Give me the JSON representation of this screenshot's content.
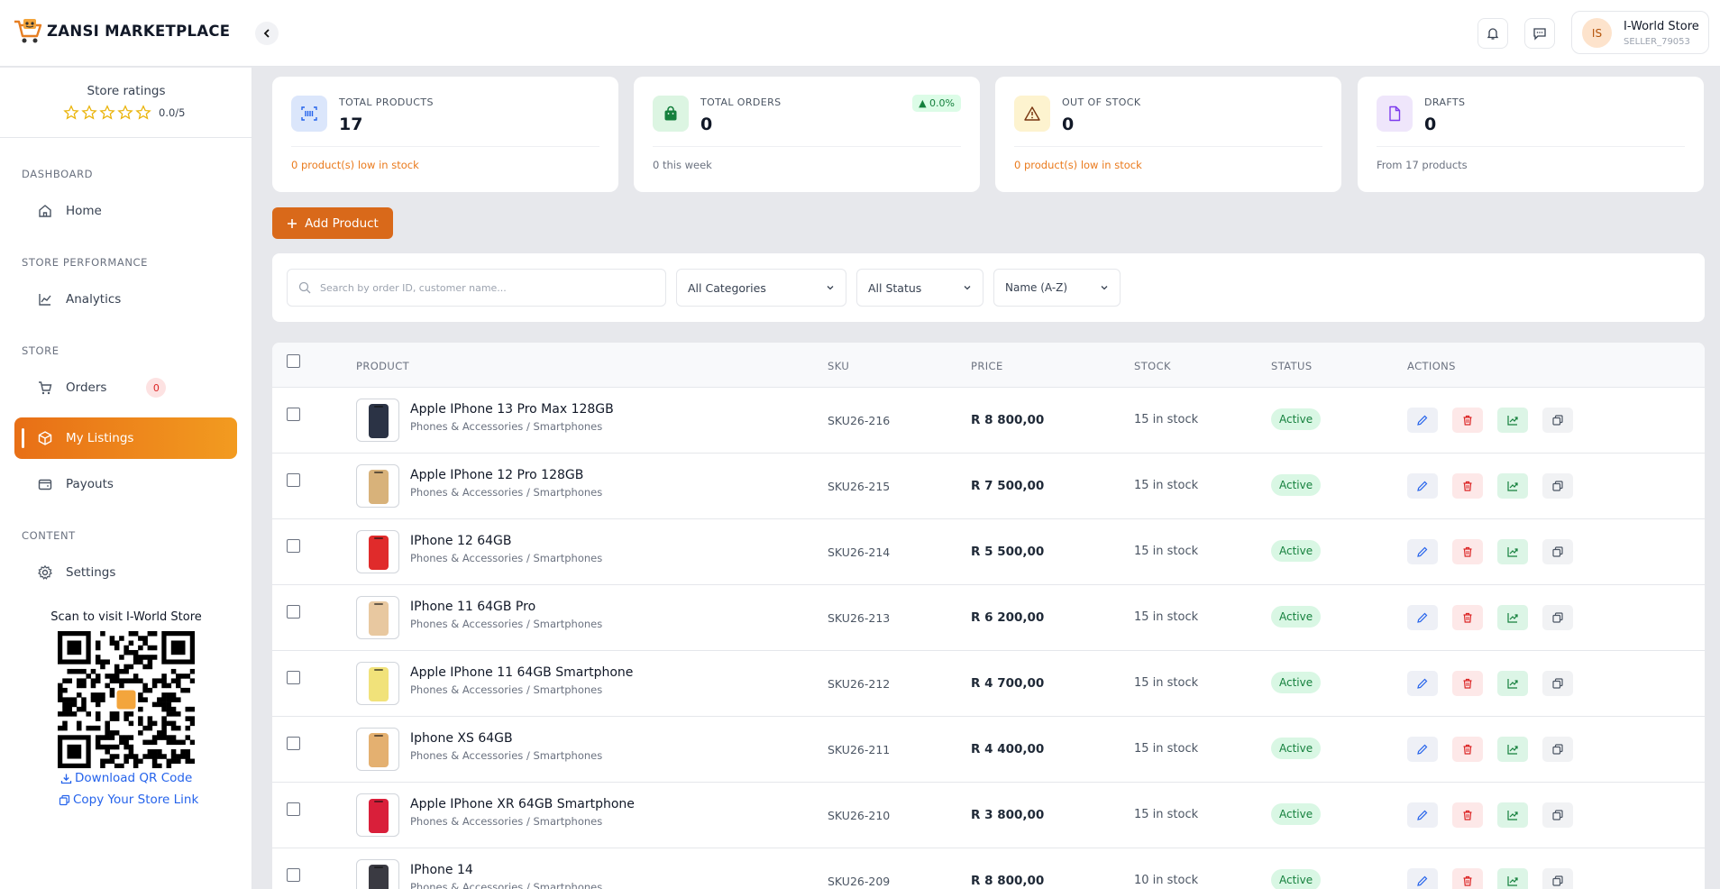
{
  "brand": {
    "name": "ZANSI MARKETPLACE"
  },
  "header": {
    "user_initials": "IS",
    "user_name": "I-World Store",
    "user_id": "SELLER_79053"
  },
  "sidebar": {
    "ratings_title": "Store ratings",
    "rating_value": "0.0/5",
    "sections": {
      "dashboard": "DASHBOARD",
      "performance": "STORE PERFORMANCE",
      "store": "STORE",
      "content": "CONTENT"
    },
    "items": {
      "home": "Home",
      "analytics": "Analytics",
      "orders": "Orders",
      "orders_badge": "0",
      "listings": "My Listings",
      "payouts": "Payouts",
      "settings": "Settings"
    },
    "qr_title": "Scan to visit I-World Store",
    "download_qr": "Download QR Code",
    "copy_link": "Copy Your Store Link"
  },
  "stats": [
    {
      "label": "TOTAL PRODUCTS",
      "value": "17",
      "footer": "0 product(s) low in stock"
    },
    {
      "label": "TOTAL ORDERS",
      "value": "0",
      "trend": "▲ 0.0%",
      "footer": "0 this week"
    },
    {
      "label": "OUT OF STOCK",
      "value": "0",
      "footer": "0 product(s) low in stock"
    },
    {
      "label": "DRAFTS",
      "value": "0",
      "footer": "From 17 products"
    }
  ],
  "add_product_label": "Add Product",
  "filters": {
    "search_placeholder": "Search by order ID, customer name...",
    "category": "All Categories",
    "status": "All Status",
    "sort": "Name (A-Z)"
  },
  "table": {
    "headers": {
      "product": "PRODUCT",
      "sku": "SKU",
      "price": "PRICE",
      "stock": "STOCK",
      "status": "STATUS",
      "actions": "ACTIONS"
    },
    "rows": [
      {
        "name": "Apple IPhone 13 Pro Max 128GB",
        "category": "Phones & Accessories / Smartphones",
        "sku": "SKU26-216",
        "price": "R 8 800,00",
        "stock": "15 in stock",
        "status": "Active",
        "color": "#2b3345"
      },
      {
        "name": "Apple IPhone 12 Pro 128GB",
        "category": "Phones & Accessories / Smartphones",
        "sku": "SKU26-215",
        "price": "R 7 500,00",
        "stock": "15 in stock",
        "status": "Active",
        "color": "#d8b27a"
      },
      {
        "name": "IPhone 12 64GB",
        "category": "Phones & Accessories / Smartphones",
        "sku": "SKU26-214",
        "price": "R 5 500,00",
        "stock": "15 in stock",
        "status": "Active",
        "color": "#e02b2b"
      },
      {
        "name": "IPhone 11 64GB Pro",
        "category": "Phones & Accessories / Smartphones",
        "sku": "SKU26-213",
        "price": "R 6 200,00",
        "stock": "15 in stock",
        "status": "Active",
        "color": "#e8c8a0"
      },
      {
        "name": "Apple IPhone 11 64GB Smartphone",
        "category": "Phones & Accessories / Smartphones",
        "sku": "SKU26-212",
        "price": "R 4 700,00",
        "stock": "15 in stock",
        "status": "Active",
        "color": "#f1e27a"
      },
      {
        "name": "Iphone XS 64GB",
        "category": "Phones & Accessories / Smartphones",
        "sku": "SKU26-211",
        "price": "R 4 400,00",
        "stock": "15 in stock",
        "status": "Active",
        "color": "#e4b070"
      },
      {
        "name": "Apple IPhone XR 64GB Smartphone",
        "category": "Phones & Accessories / Smartphones",
        "sku": "SKU26-210",
        "price": "R 3 800,00",
        "stock": "15 in stock",
        "status": "Active",
        "color": "#d91f3a"
      },
      {
        "name": "IPhone 14",
        "category": "Phones & Accessories / Smartphones",
        "sku": "SKU26-209",
        "price": "R 8 800,00",
        "stock": "10 in stock",
        "status": "Active",
        "color": "#3a3a42"
      }
    ]
  },
  "colors": {
    "accent": "#e86f16",
    "success": "#15803d",
    "danger": "#dc2626",
    "link": "#2563eb"
  }
}
